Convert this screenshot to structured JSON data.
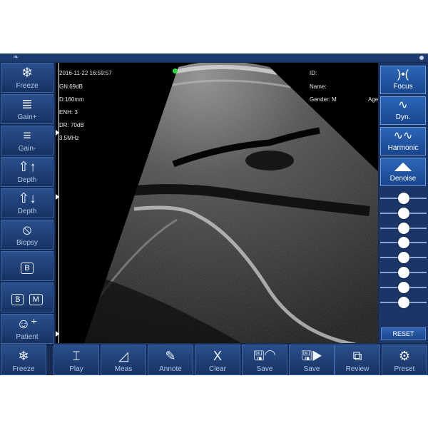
{
  "left_toolbar": {
    "freeze_label": "Freeze",
    "gain_plus_label": "Gain+",
    "gain_minus_label": "Gain-",
    "depth_up_label": "Depth",
    "depth_down_label": "Depth",
    "biopsy_label": "Biopsy",
    "b_mode_label": "B",
    "bm_b_label": "B",
    "bm_m_label": "M",
    "patient_label": "Patient"
  },
  "image": {
    "datetime": "2016-11-22 16:59:57",
    "gain": "GN:69dB",
    "depth": "D:160mm",
    "enhance": "ENH: 3",
    "dynamic_range": "DR: 70dB",
    "frequency": "3.5MHz",
    "id_label": "ID:",
    "name_label": "Name:",
    "gender": "Gender: M",
    "age_label": "Age"
  },
  "right_panel": {
    "focus_label": "Focus",
    "dyn_label": "Dyn.",
    "harmonic_label": "Harmonic",
    "denoise_label": "Denoise",
    "tgc_levels": [
      0.5,
      0.5,
      0.5,
      0.5,
      0.5,
      0.5,
      0.5,
      0.5
    ],
    "reset_label": "RESET"
  },
  "bottom_toolbar": {
    "freeze_label": "Freeze",
    "play_label": "Play",
    "meas_label": "Meas",
    "annote_label": "Annote",
    "clear_label": "Clear",
    "clear_icon": "X",
    "save_image_label": "Save",
    "save_cine_label": "Save",
    "review_label": "Review",
    "preset_label": "Preset"
  },
  "colors": {
    "panel_bg": "#142a52",
    "button_accent": "#2c66b8",
    "focus_dot": "#29e03a"
  }
}
